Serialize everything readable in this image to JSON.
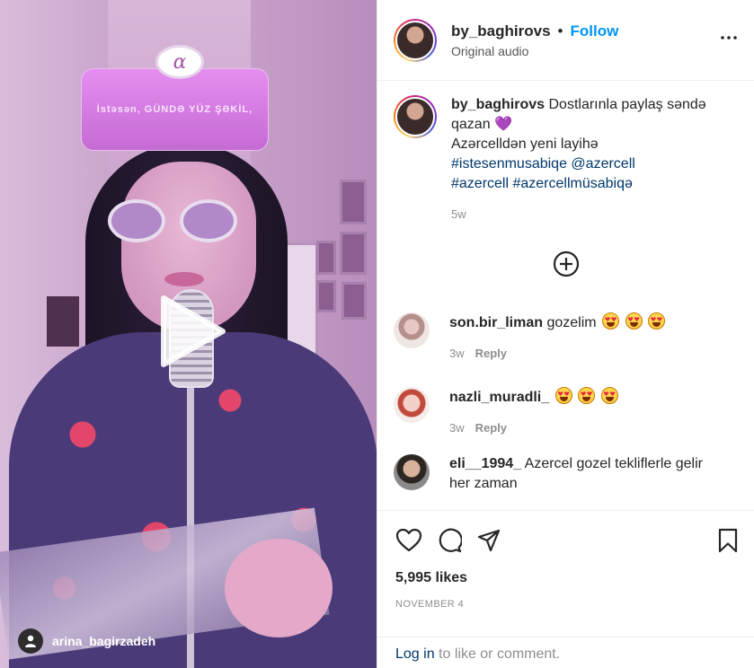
{
  "media": {
    "filter_text": "İstəsən, GÜNDƏ YÜZ ŞƏKİL,",
    "filter_logo": "ɑ",
    "tagged_user": "arina_bagirzadeh"
  },
  "header": {
    "username": "by_baghirovs",
    "separator": "•",
    "follow_label": "Follow",
    "subtitle": "Original audio"
  },
  "caption": {
    "username": "by_baghirovs",
    "text1": "Dostlarınla paylaş səndə qazan",
    "heart": "💜",
    "text2": "Azərcelldən yeni layihə",
    "tag1": "#istesenmusabiqe",
    "tag2": "@azercell",
    "tag3": "#azercell",
    "tag4": "#azercellmüsabiqə",
    "time": "5w"
  },
  "comments": [
    {
      "username": "son.bir_liman",
      "text": "gozelim",
      "emoji_count": 3,
      "time": "3w",
      "reply": "Reply"
    },
    {
      "username": "nazli_muradli_",
      "text": "",
      "emoji_count": 3,
      "time": "3w",
      "reply": "Reply"
    },
    {
      "username": "eli__1994_",
      "text": "Azercel gozel tekliflerle gelir her zaman"
    }
  ],
  "stats": {
    "likes": "5,995 likes",
    "date": "NOVEMBER 4"
  },
  "login": {
    "link": "Log in",
    "rest": " to like or comment."
  },
  "colors": {
    "link_blue": "#0095f6",
    "hashtag": "#00376b",
    "muted": "#8e8e8e"
  },
  "icons": [
    "play-icon",
    "more-icon",
    "load-more-icon",
    "heart-icon",
    "comment-icon",
    "share-icon",
    "save-icon",
    "user-tag-icon"
  ]
}
